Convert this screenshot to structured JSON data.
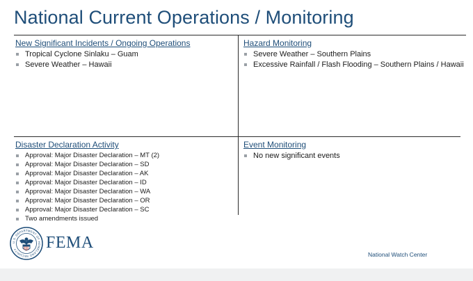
{
  "title": "National Current Operations / Monitoring",
  "incidents": {
    "heading": "New Significant Incidents / Ongoing Operations",
    "items": [
      "Tropical Cyclone Sinlaku – Guam",
      "Severe Weather – Hawaii"
    ]
  },
  "hazard": {
    "heading": "Hazard Monitoring",
    "items": [
      "Severe Weather – Southern Plains",
      "Excessive Rainfall / Flash Flooding – Southern Plains / Hawaii"
    ]
  },
  "disaster": {
    "heading": "Disaster Declaration Activity",
    "items": [
      "Approval: Major Disaster Declaration – MT (2)",
      "Approval: Major Disaster Declaration – SD",
      "Approval: Major Disaster Declaration – AK",
      "Approval: Major Disaster Declaration – ID",
      "Approval: Major Disaster Declaration – WA",
      "Approval: Major Disaster Declaration – OR",
      "Approval: Major Disaster Declaration – SC",
      "Two amendments issued"
    ]
  },
  "event": {
    "heading": "Event Monitoring",
    "items": [
      "No new significant events"
    ]
  },
  "branding": {
    "logo_text": "FEMA",
    "seal_text": "U.S. DEPARTMENT OF HOMELAND SECURITY",
    "footer": "National Watch Center"
  },
  "colors": {
    "accent": "#1f4e79",
    "bullet": "#9aa0a6",
    "rule": "#2b2b2b"
  }
}
